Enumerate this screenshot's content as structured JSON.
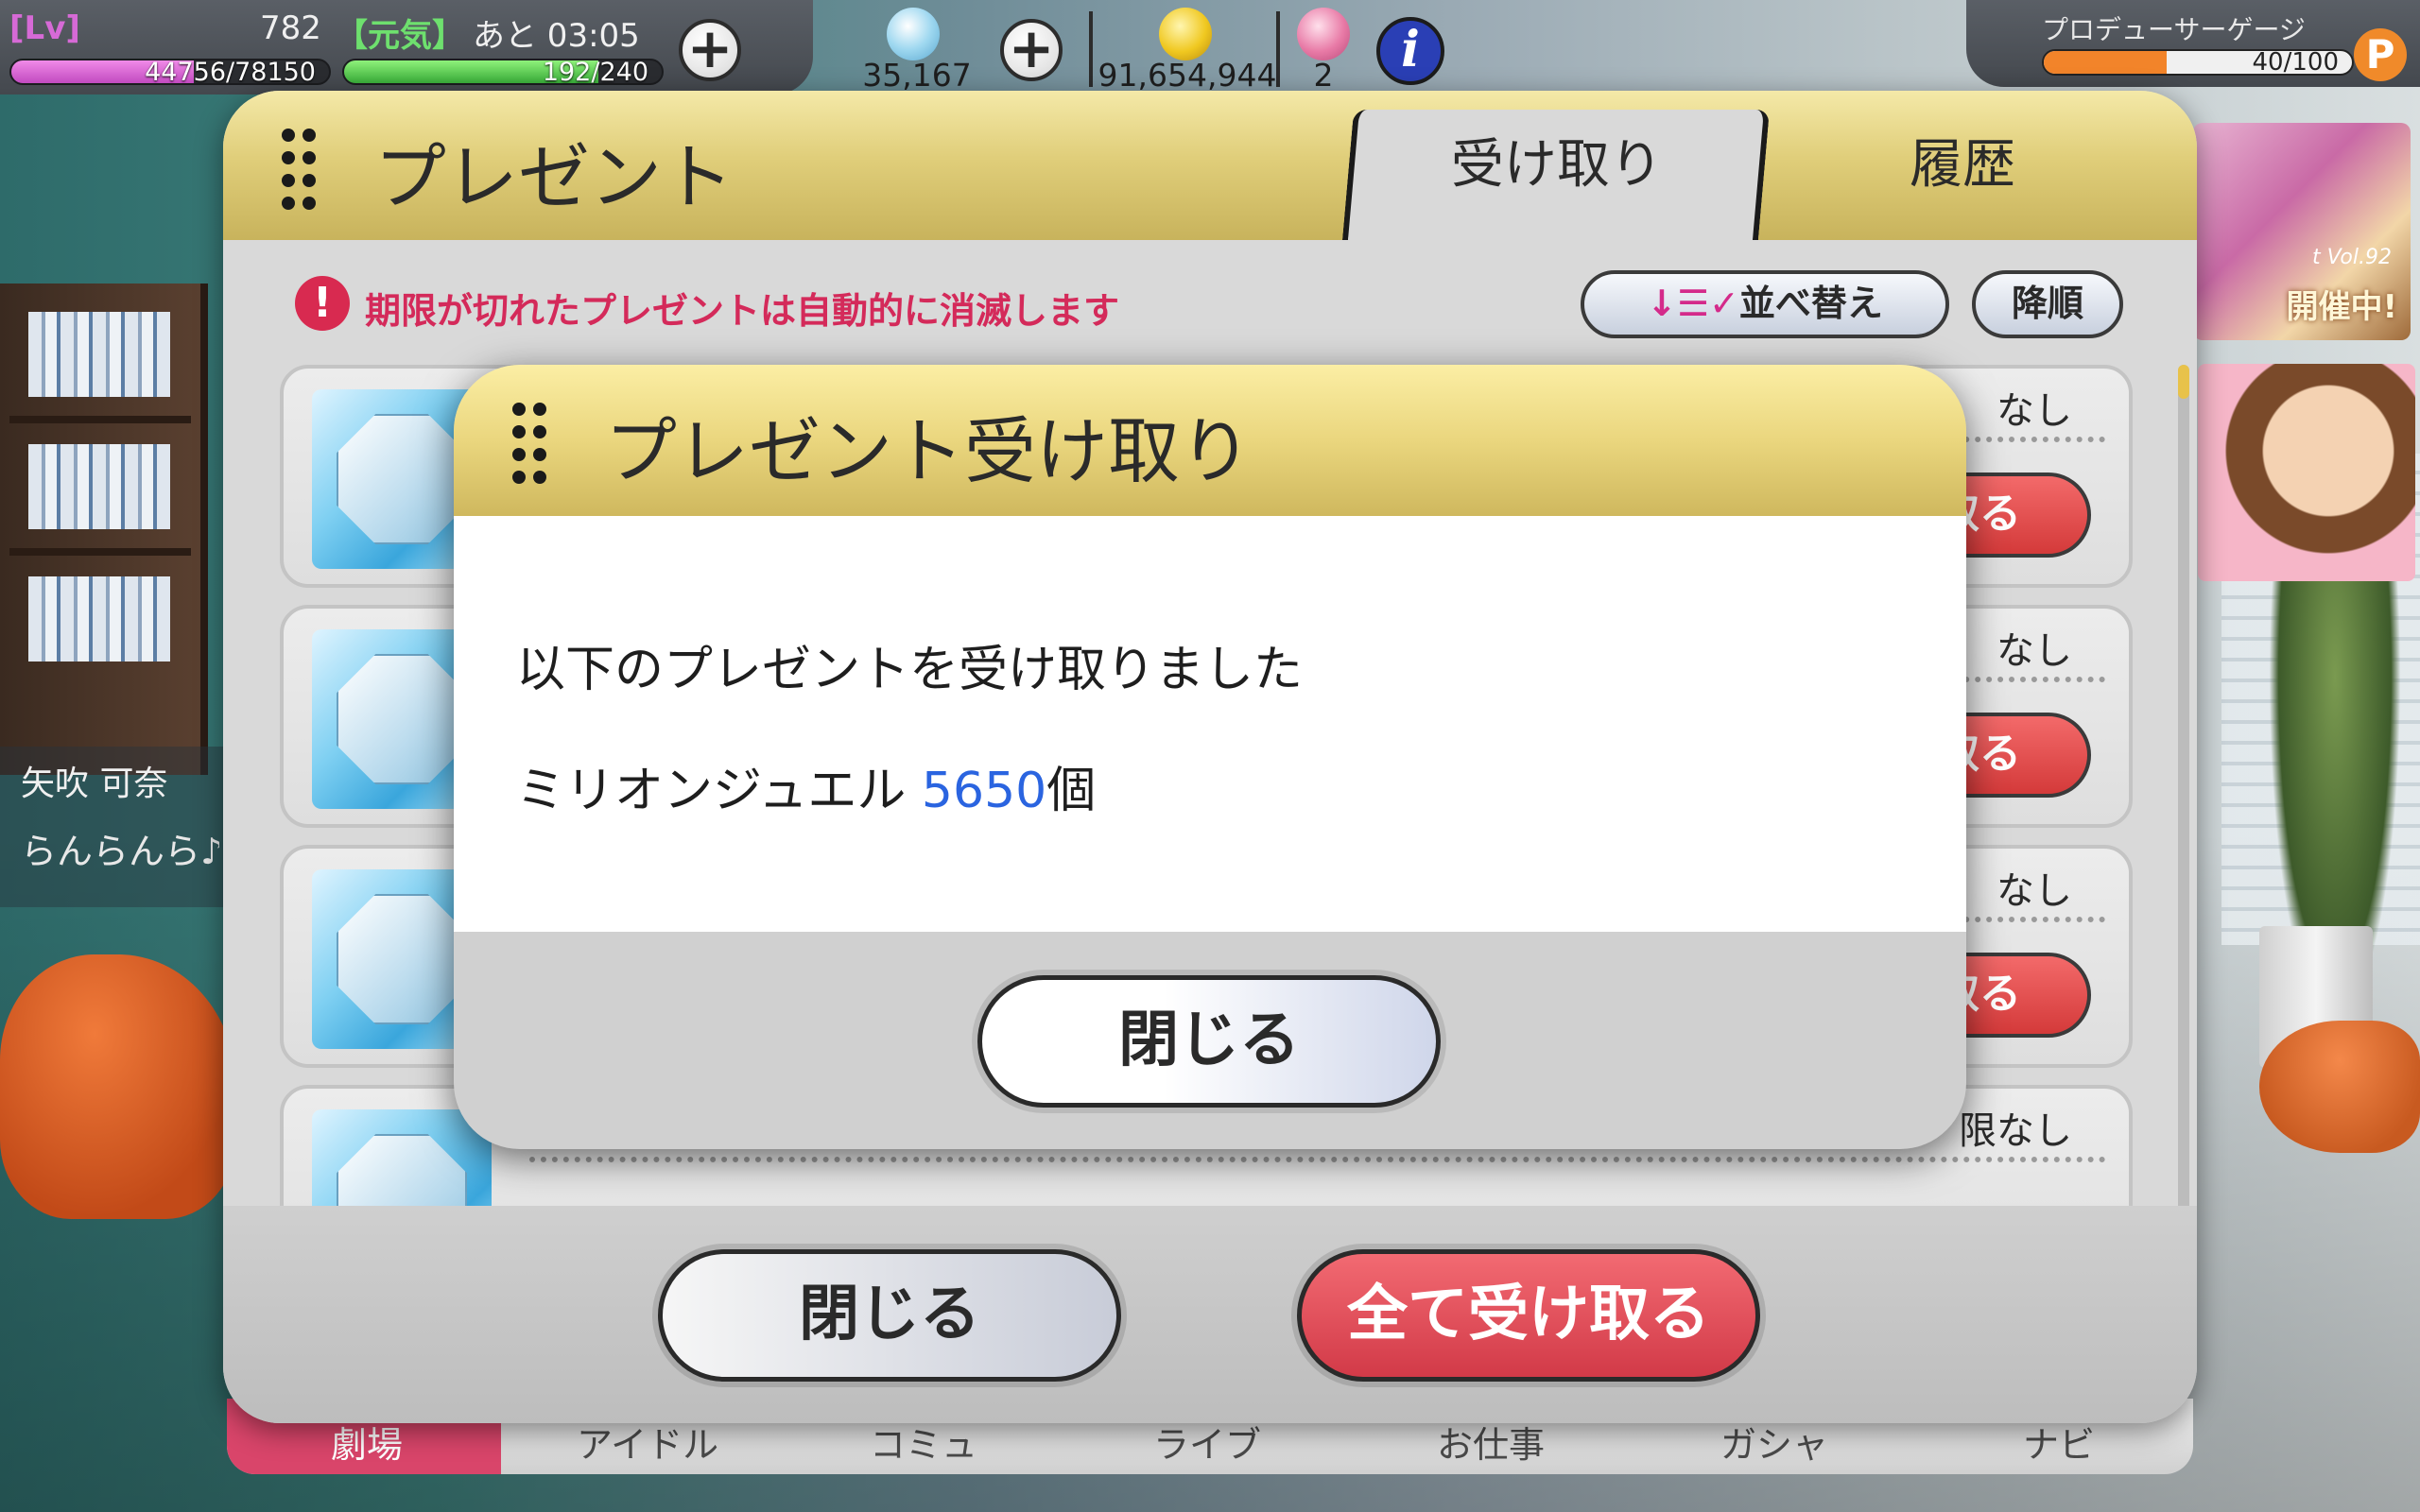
{
  "hud": {
    "lv_label": "[Lv]",
    "lv_value": "782",
    "genki_label": "【元気】",
    "timer": "あと 03:05",
    "exp_text": "44756/78150",
    "exp_fraction": 0.573,
    "stamina_text": "192/240",
    "stamina_fraction": 0.8,
    "jewels": "35,167",
    "money": "91,654,944",
    "tickets": "2",
    "info_label": "i",
    "producer_gauge_label": "プロデューサーゲージ",
    "producer_gauge_text": "40/100",
    "producer_gauge_fraction": 0.4,
    "producer_icon": "P",
    "plus_label": "+"
  },
  "banner": {
    "vol_text": "t Vol.92",
    "status": "開催中!"
  },
  "character": {
    "name": "矢吹 可奈",
    "line": "らんらんら♪"
  },
  "panel": {
    "title": "プレゼント",
    "tabs": [
      {
        "label": "受け取り",
        "active": true
      },
      {
        "label": "履歴",
        "active": false
      }
    ],
    "warning_icon": "!",
    "warning": "期限が切れたプレゼントは自動的に消滅します",
    "sort_icon": "↓☰✓",
    "sort_label": "並べ替え",
    "order_label": "降順",
    "items": [
      {
        "limit": "なし",
        "button": "取る"
      },
      {
        "limit": "なし",
        "button": "取る"
      },
      {
        "limit": "なし",
        "button": "取る"
      },
      {
        "limit": "限なし",
        "button": ""
      }
    ],
    "close_label": "閉じる",
    "receive_all_label": "全て受け取る"
  },
  "nav": {
    "items": [
      "劇場",
      "アイドル",
      "コミュ",
      "ライブ",
      "お仕事",
      "ガシャ",
      "ナビ"
    ]
  },
  "dialog": {
    "title": "プレゼント受け取り",
    "message": "以下のプレゼントを受け取りました",
    "item_name": "ミリオンジュエル",
    "quantity": "5650",
    "unit": "個",
    "close_label": "閉じる"
  },
  "colors": {
    "header_gold": "#e0ce7a",
    "warning_red": "#d42a5a",
    "quantity_blue": "#2a64e0",
    "receive_red": "#d23a48"
  }
}
